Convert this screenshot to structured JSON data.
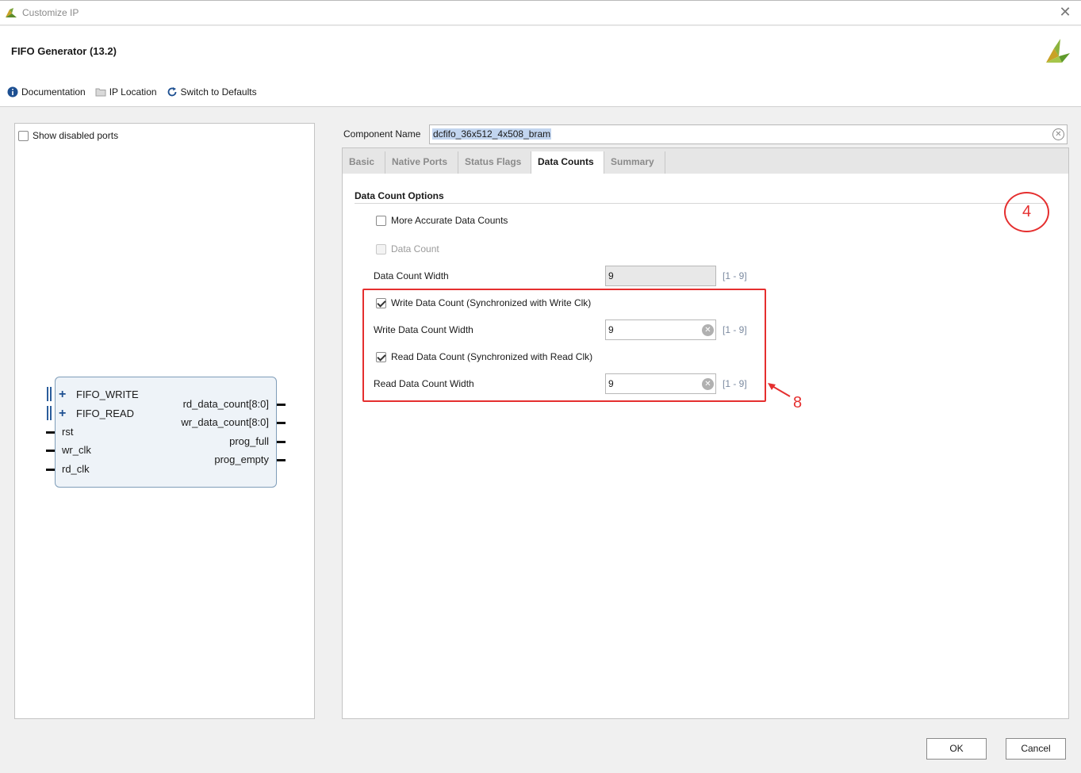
{
  "window": {
    "title": "Customize IP",
    "close_glyph": "✕"
  },
  "header": {
    "title": "FIFO Generator (13.2)",
    "toolbar": [
      {
        "label": "Documentation",
        "icon": "info-icon"
      },
      {
        "label": "IP Location",
        "icon": "folder-icon"
      },
      {
        "label": "Switch to Defaults",
        "icon": "refresh-icon"
      }
    ]
  },
  "left_pane": {
    "show_disabled_ports_label": "Show disabled ports",
    "show_disabled_ports_checked": false,
    "symbol": {
      "left_ports": [
        "FIFO_WRITE",
        "FIFO_READ",
        "rst",
        "wr_clk",
        "rd_clk"
      ],
      "right_ports": [
        "rd_data_count[8:0]",
        "wr_data_count[8:0]",
        "prog_full",
        "prog_empty"
      ]
    }
  },
  "component": {
    "label": "Component Name",
    "value": "dcfifo_36x512_4x508_bram"
  },
  "tabs": [
    "Basic",
    "Native Ports",
    "Status Flags",
    "Data Counts",
    "Summary"
  ],
  "active_tab": "Data Counts",
  "section": {
    "title": "Data Count Options",
    "more_accurate": {
      "label": "More Accurate Data Counts",
      "checked": false
    },
    "data_count": {
      "label": "Data Count",
      "checked": false,
      "disabled": true
    },
    "data_count_width": {
      "label": "Data Count Width",
      "value": "9",
      "range": "[1 - 9]"
    },
    "write_data_count": {
      "label": "Write Data Count (Synchronized with Write Clk)",
      "checked": true
    },
    "write_data_count_width": {
      "label": "Write Data Count Width",
      "value": "9",
      "range": "[1 - 9]"
    },
    "read_data_count": {
      "label": "Read Data Count (Synchronized with Read Clk)",
      "checked": true
    },
    "read_data_count_width": {
      "label": "Read Data Count Width",
      "value": "9",
      "range": "[1 - 9]"
    }
  },
  "annotations": {
    "circle_number": "4",
    "arrow_number": "8",
    "color": "#e52f2f"
  },
  "buttons": {
    "ok": "OK",
    "cancel": "Cancel"
  }
}
